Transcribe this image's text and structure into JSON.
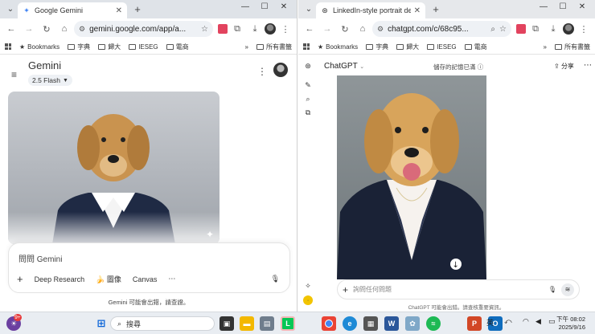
{
  "left_window": {
    "tab": {
      "title": "Google Gemini",
      "icon": "gemini-icon"
    },
    "url": "gemini.google.com/app/a...",
    "bookmarks": [
      "Bookmarks",
      "字典",
      "歸大",
      "IESEG",
      "電商"
    ],
    "bookmarks_overflow": "»",
    "all_bookmarks": "所有書籤",
    "app": {
      "title": "Gemini",
      "model": "2.5 Flash",
      "input_placeholder": "問問 Gemini",
      "tools": [
        "Deep Research",
        "圖像",
        "Canvas"
      ],
      "footer": "Gemini 可能會出錯，請查證。"
    }
  },
  "right_window": {
    "tab": {
      "title": "LinkedIn-style portrait design",
      "icon": "chatgpt-icon"
    },
    "url": "chatgpt.com/c/68c95...",
    "bookmarks": [
      "Bookmarks",
      "字典",
      "歸大",
      "IESEG",
      "電商"
    ],
    "bookmarks_overflow": "»",
    "all_bookmarks": "所有書籤",
    "app": {
      "title": "ChatGPT",
      "memory": "儲存的記憶已滿",
      "share": "分享",
      "input_placeholder": "詢問任何問題",
      "footer": "ChatGPT 可能會出錯。請查核重要資訊。"
    }
  },
  "taskbar": {
    "search_placeholder": "搜尋",
    "notification_count": "9+",
    "ime": "英",
    "time": "下午 08:02",
    "date": "2025/9/16"
  },
  "colors": {
    "gemini_accent": "#4285f4",
    "line_green": "#06c755",
    "word_blue": "#2b579a",
    "outlook_blue": "#0f6cbd"
  }
}
